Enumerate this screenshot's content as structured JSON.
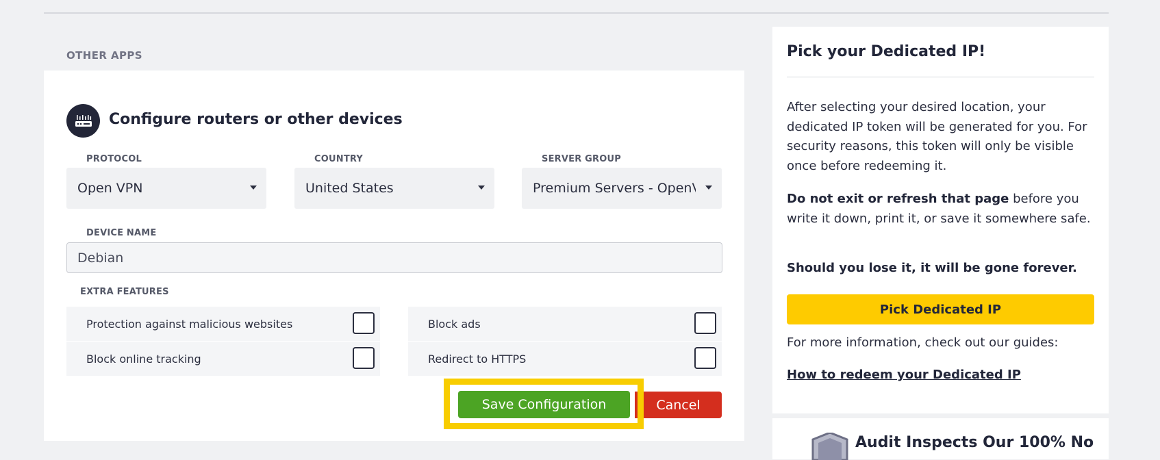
{
  "section": {
    "label": "OTHER APPS"
  },
  "config": {
    "title": "Configure routers or other devices",
    "icon": "router-icon",
    "protocol": {
      "label": "PROTOCOL",
      "value": "Open VPN"
    },
    "country": {
      "label": "COUNTRY",
      "value": "United States"
    },
    "server_group": {
      "label": "SERVER GROUP",
      "value": "Premium Servers - OpenVPN"
    },
    "device_name": {
      "label": "DEVICE NAME",
      "value": "Debian"
    },
    "extra_features": {
      "label": "EXTRA FEATURES",
      "items": [
        {
          "label": "Protection against malicious websites",
          "checked": false
        },
        {
          "label": "Block ads",
          "checked": false
        },
        {
          "label": "Block online tracking",
          "checked": false
        },
        {
          "label": "Redirect to HTTPS",
          "checked": false
        }
      ]
    },
    "save_label": "Save Configuration",
    "cancel_label": "Cancel"
  },
  "dedicated_ip": {
    "title": "Pick your Dedicated IP!",
    "intro": "After selecting your desired location, your dedicated IP token will be generated for you. For security reasons, this token will only be visible once before redeeming it.",
    "warning_bold": "Do not exit or refresh that page",
    "warning_rest": " before you write it down, print it, or save it somewhere safe.",
    "lose_warning": "Should you lose it, it will be gone forever.",
    "button_label": "Pick Dedicated IP",
    "more_info": "For more information, check out our guides:",
    "guide_link": "How to redeem your Dedicated IP"
  },
  "audit": {
    "title": "Audit Inspects Our 100% No",
    "icon": "shield-icon"
  },
  "colors": {
    "save": "#4ca424",
    "cancel": "#d42e1e",
    "highlight": "#f8cd01",
    "pick": "#fecb00",
    "dark": "#232638"
  }
}
